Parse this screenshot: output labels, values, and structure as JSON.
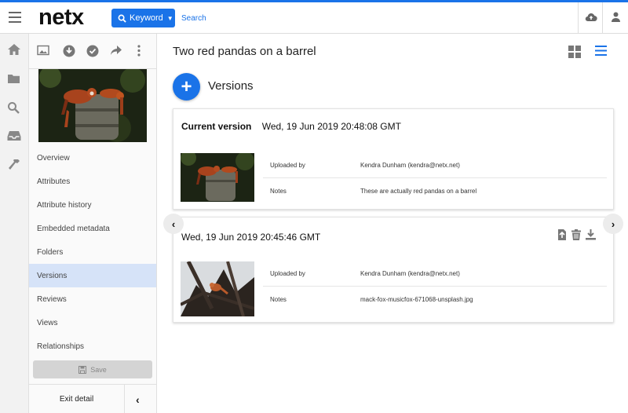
{
  "header": {
    "logo": "netx",
    "search_type_label": "Keyword",
    "search_placeholder": "Search",
    "accent_color": "#1a73e8",
    "icons": [
      "menu-icon",
      "search-icon",
      "cloud-upload-icon",
      "user-icon"
    ]
  },
  "rail": {
    "items": [
      "home-icon",
      "folder-icon",
      "search-icon",
      "inbox-icon",
      "hammer-icon"
    ]
  },
  "panel": {
    "tool_icons": [
      "image-icon",
      "download-icon",
      "check-icon",
      "share-icon",
      "more-icon"
    ],
    "nav_items": [
      {
        "label": "Overview",
        "active": false
      },
      {
        "label": "Attributes",
        "active": false
      },
      {
        "label": "Attribute history",
        "active": false
      },
      {
        "label": "Embedded metadata",
        "active": false
      },
      {
        "label": "Folders",
        "active": false
      },
      {
        "label": "Versions",
        "active": true
      },
      {
        "label": "Reviews",
        "active": false
      },
      {
        "label": "Views",
        "active": false
      },
      {
        "label": "Relationships",
        "active": false
      }
    ],
    "save_label": "Save",
    "exit_label": "Exit detail"
  },
  "main": {
    "asset_title": "Two red pandas on a barrel",
    "versions_heading": "Versions",
    "versions": [
      {
        "is_current": true,
        "current_label": "Current version",
        "date": "Wed, 19 Jun 2019 20:48:08 GMT",
        "uploaded_by_label": "Uploaded by",
        "uploaded_by": "Kendra Dunham (kendra@netx.net)",
        "notes_label": "Notes",
        "notes": "These are actually red pandas on a barrel"
      },
      {
        "is_current": false,
        "date": "Wed, 19 Jun 2019 20:45:46 GMT",
        "uploaded_by_label": "Uploaded by",
        "uploaded_by": "Kendra Dunham (kendra@netx.net)",
        "notes_label": "Notes",
        "notes": "mack-fox-musicfox-671068-unsplash.jpg",
        "actions": [
          "make-current-icon",
          "trash-icon",
          "download-icon"
        ]
      }
    ]
  }
}
